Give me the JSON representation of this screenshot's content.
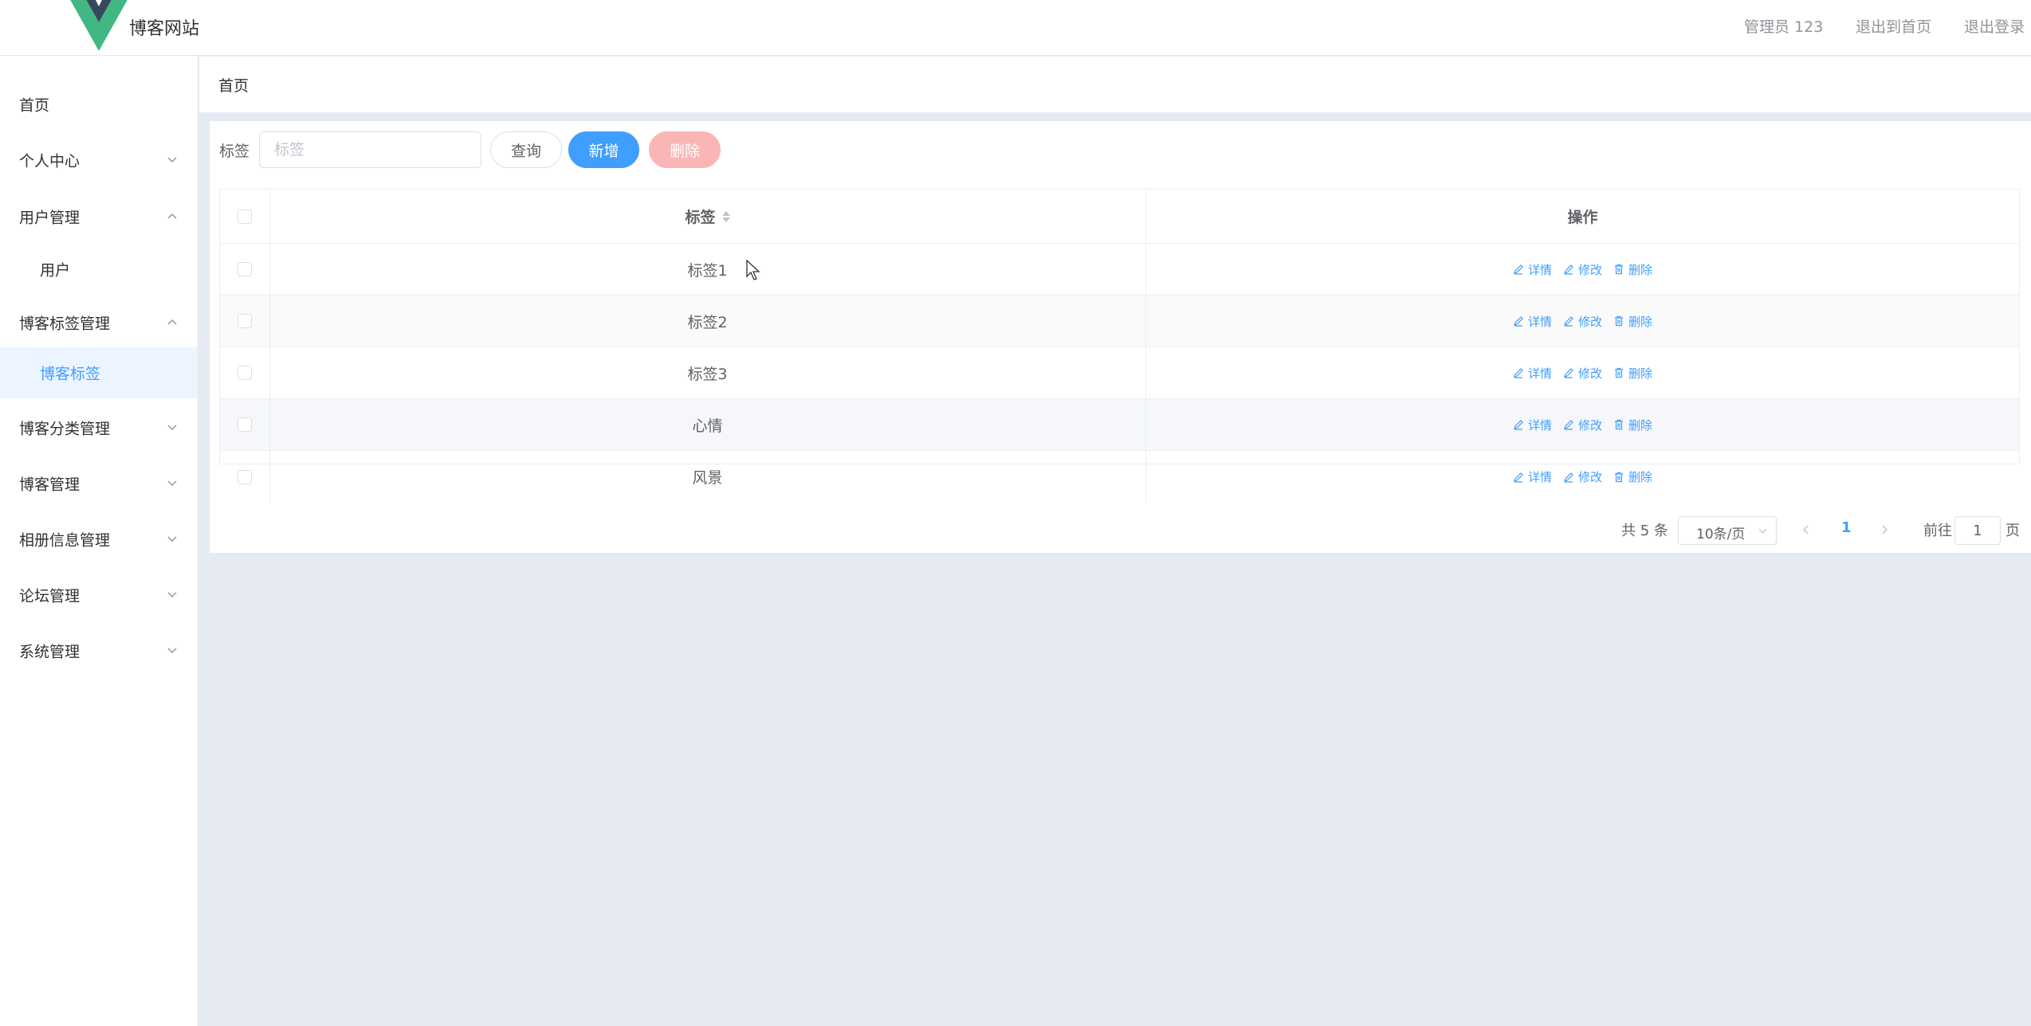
{
  "header": {
    "site_title": "博客网站",
    "user_label": "管理员 123",
    "home_link": "退出到首页",
    "logout_link": "退出登录",
    "logo_colors": {
      "outer": "#41b883",
      "inner": "#35495e"
    }
  },
  "sidebar": {
    "items": [
      {
        "label": "首页",
        "arrow": ""
      },
      {
        "label": "个人中心",
        "arrow": "down"
      },
      {
        "label": "用户管理",
        "arrow": "up"
      },
      {
        "label": "用户",
        "arrow": ""
      },
      {
        "label": "博客标签管理",
        "arrow": "up"
      },
      {
        "label": "博客标签",
        "arrow": "",
        "active": true
      },
      {
        "label": "博客分类管理",
        "arrow": "down"
      },
      {
        "label": "博客管理",
        "arrow": "down"
      },
      {
        "label": "相册信息管理",
        "arrow": "down"
      },
      {
        "label": "论坛管理",
        "arrow": "down"
      },
      {
        "label": "系统管理",
        "arrow": "down"
      }
    ]
  },
  "breadcrumb": {
    "current": "首页"
  },
  "search": {
    "label": "标签",
    "placeholder": "标签",
    "query_label": "查询",
    "add_label": "新增",
    "delete_label": "删除"
  },
  "table": {
    "columns": [
      "标签",
      "操作"
    ],
    "rows": [
      {
        "tag": "标签1"
      },
      {
        "tag": "标签2"
      },
      {
        "tag": "标签3"
      },
      {
        "tag": "心情"
      },
      {
        "tag": "风景"
      }
    ],
    "actions": {
      "detail": "详情",
      "edit": "修改",
      "delete": "删除"
    }
  },
  "pagination": {
    "total": "共 5 条",
    "page_size": "10条/页",
    "current_page": "1",
    "goto_label": "前往",
    "goto_value": "1",
    "page_suffix": "页"
  },
  "colors": {
    "primary": "#409eff",
    "danger_disabled": "#fab6b6",
    "background": "#e6ebf3"
  }
}
